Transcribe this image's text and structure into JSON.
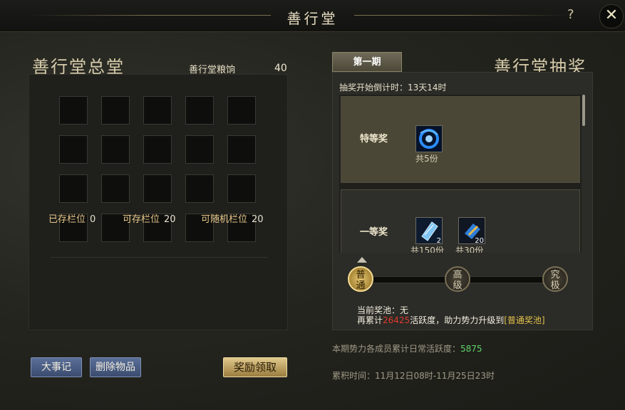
{
  "window": {
    "title": "善行堂"
  },
  "left": {
    "heading": "善行堂总堂",
    "grain_label": "善行堂粮饷",
    "grain_value": "40",
    "slot_count": 20,
    "stats": [
      {
        "label": "已存栏位",
        "value": "0"
      },
      {
        "label": "可存栏位",
        "value": "20"
      },
      {
        "label": "可随机栏位",
        "value": "20"
      }
    ],
    "buttons": {
      "events": "大事记",
      "delete": "删除物品",
      "claim": "奖励领取"
    }
  },
  "right": {
    "tab": "第一期",
    "heading": "善行堂抽奖",
    "countdown": "抽奖开始倒计时：13天14时",
    "prizes": [
      {
        "name": "特等奖",
        "items": [
          {
            "icon": "blue-vortex-orb-icon",
            "badge": "",
            "count": "共5份"
          }
        ]
      },
      {
        "name": "一等奖",
        "items": [
          {
            "icon": "crystal-scroll-icon",
            "badge": "2",
            "count": "共150份"
          },
          {
            "icon": "blue-gold-crystal-icon",
            "badge": "20",
            "count": "共30份"
          }
        ]
      }
    ],
    "tiers": [
      {
        "label_line1": "普",
        "label_line2": "通",
        "state": "active"
      },
      {
        "label_line1": "高",
        "label_line2": "级",
        "state": "idle"
      },
      {
        "label_line1": "究",
        "label_line2": "极",
        "state": "idle"
      }
    ],
    "pool": {
      "line1": "当前奖池：无",
      "line2_prefix": "再累计",
      "line2_amount": "26425",
      "line2_mid": "活跃度，助力势力升级到",
      "line2_target": "[普通奖池]"
    },
    "daily_activity_label": "本期势力各成员累计日常活跃度：",
    "daily_activity_value": "5875",
    "period": "累积时间：11月12日08时-11月25日23时"
  },
  "colors": {
    "accent_gold": "#e2c24b",
    "highlight_red": "#e03a2d",
    "activity_green": "#5fd46a",
    "button_blue": "#4b5e86"
  }
}
